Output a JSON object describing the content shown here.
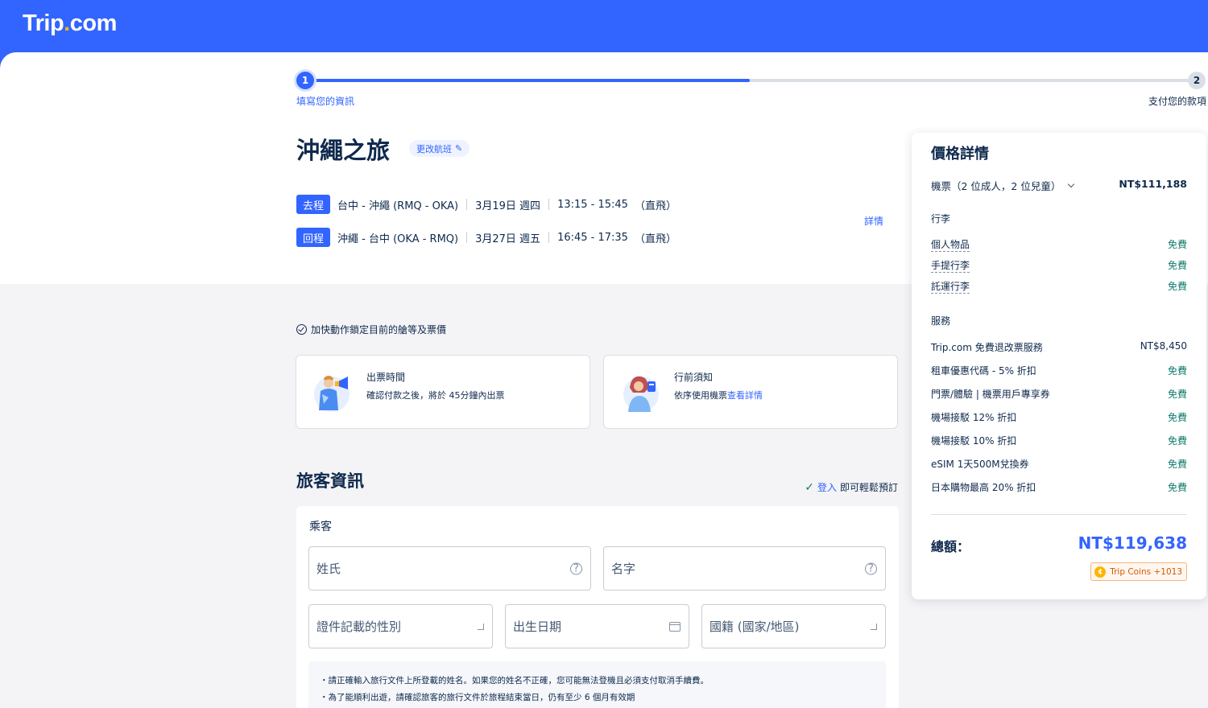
{
  "header": {
    "logo_main": "Trip",
    "logo_dot": ".",
    "logo_suffix": "com"
  },
  "steps": [
    {
      "number": "1",
      "label": "填寫您的資訊"
    },
    {
      "number": "2",
      "label": "支付您的款項"
    }
  ],
  "progress": 0.5,
  "trip": {
    "title": "沖繩之旅",
    "change_flight": "更改航班",
    "details_link": "詳情",
    "outbound": {
      "tag": "去程",
      "route": "台中 - 沖繩 (RMQ - OKA)",
      "date": "3月19日 週四",
      "time": "13:15 - 15:45",
      "type": "（直飛）"
    },
    "return": {
      "tag": "回程",
      "route": "沖繩 - 台中 (OKA - RMQ)",
      "date": "3月27日 週五",
      "time": "16:45 - 17:35",
      "type": "（直飛）"
    }
  },
  "lock_notice": "加快動作鎖定目前的艙等及票價",
  "cards": [
    {
      "title": "出票時間",
      "desc": "確認付款之後，將於 45分鐘內出票",
      "link": ""
    },
    {
      "title": "行前須知",
      "desc": "依序使用機票",
      "link": "查看詳情"
    }
  ],
  "traveler": {
    "section_title": "旅客資訊",
    "login_link": "登入",
    "login_text": "即可輕鬆預訂",
    "passenger_label": "乘客",
    "fields": {
      "last_name": "姓氏",
      "first_name": "名字",
      "gender": "證件記載的性別",
      "dob": "出生日期",
      "nationality": "國籍 (國家/地區)"
    },
    "notices": [
      "・請正確輸入旅行文件上所登載的姓名。如果您的姓名不正確，您可能無法登機且必須支付取消手續費。",
      "・為了能順利出遊，請確認旅客的旅行文件於旅程結束當日，仍有至少 6 個月有效期"
    ]
  },
  "price": {
    "title": "價格詳情",
    "ticket_label": "機票（2 位成人，2 位兒童）",
    "ticket_price": "NT$111,188",
    "baggage_heading": "行李",
    "baggage": [
      {
        "name": "個人物品",
        "value": "免費"
      },
      {
        "name": "手提行李",
        "value": "免費"
      },
      {
        "name": "託運行李",
        "value": "免費"
      }
    ],
    "services_heading": "服務",
    "services": [
      {
        "name": "Trip.com 免費退改票服務",
        "value": "NT$8,450"
      },
      {
        "name": "租車優惠代碼 - 5% 折扣",
        "value": "免費"
      },
      {
        "name": "門票/體驗 | 機票用戶專享券",
        "value": "免費"
      },
      {
        "name": "機場接駁 12% 折扣",
        "value": "免費"
      },
      {
        "name": "機場接駁 10% 折扣",
        "value": "免費"
      },
      {
        "name": "eSIM 1天500M兌換券",
        "value": "免費"
      },
      {
        "name": "日本購物最高 20% 折扣",
        "value": "免費"
      }
    ],
    "total_label": "總額：",
    "total": "NT$119,638",
    "coins": "Trip Coins +1013"
  },
  "colors": {
    "brand": "#3264ff",
    "free": "#0f7b6c",
    "text": "#0f294d"
  }
}
